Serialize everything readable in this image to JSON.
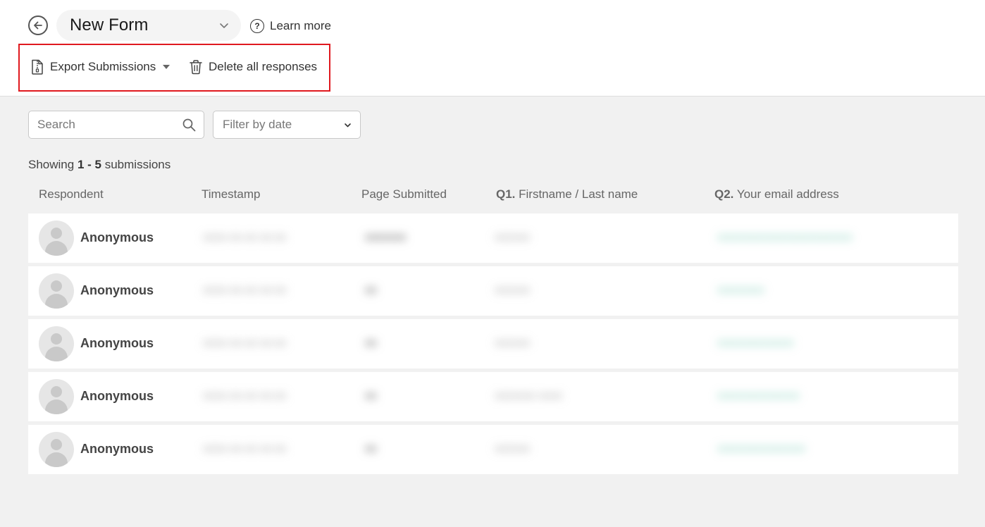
{
  "header": {
    "form_title": "New Form",
    "learn_more": "Learn more",
    "help_glyph": "?"
  },
  "actions": {
    "export_label": "Export Submissions",
    "delete_label": "Delete all responses"
  },
  "filters": {
    "search_placeholder": "Search",
    "date_placeholder": "Filter by date"
  },
  "summary": {
    "prefix": "Showing",
    "range": "1 - 5",
    "suffix": "submissions"
  },
  "table": {
    "columns": {
      "respondent": "Respondent",
      "timestamp": "Timestamp",
      "page": "Page Submitted",
      "q1_num": "Q1.",
      "q1_text": "Firstname / Last name",
      "q2_num": "Q2.",
      "q2_text": "Your email address"
    },
    "rows": [
      {
        "respondent": "Anonymous",
        "timestamp": "0000-00-00 00:00",
        "page": "0000000",
        "q1": "000000",
        "email": "00000000000000000000000"
      },
      {
        "respondent": "Anonymous",
        "timestamp": "0000-00-00 00:00",
        "page": "00",
        "q1": "000000",
        "email": "00000000"
      },
      {
        "respondent": "Anonymous",
        "timestamp": "0000-00-00 00:00",
        "page": "00",
        "q1": "000000",
        "email": "0000000000000"
      },
      {
        "respondent": "Anonymous",
        "timestamp": "0000-00-00 00:00",
        "page": "00",
        "q1": "0000000 0000",
        "email": "00000000000000"
      },
      {
        "respondent": "Anonymous",
        "timestamp": "0000-00-00 00:00",
        "page": "00",
        "q1": "000000",
        "email": "000000000000000"
      }
    ]
  },
  "colors": {
    "highlight_border": "#e0191f",
    "page_background": "#f1f1f1",
    "email_accent": "#5fc2a8"
  },
  "icons": {
    "back": "arrow-left-circle-icon",
    "dropdown": "chevron-down-icon",
    "help": "question-circle-icon",
    "export": "zip-file-icon",
    "delete": "trash-icon",
    "search": "search-icon",
    "avatar": "user-placeholder-icon"
  }
}
